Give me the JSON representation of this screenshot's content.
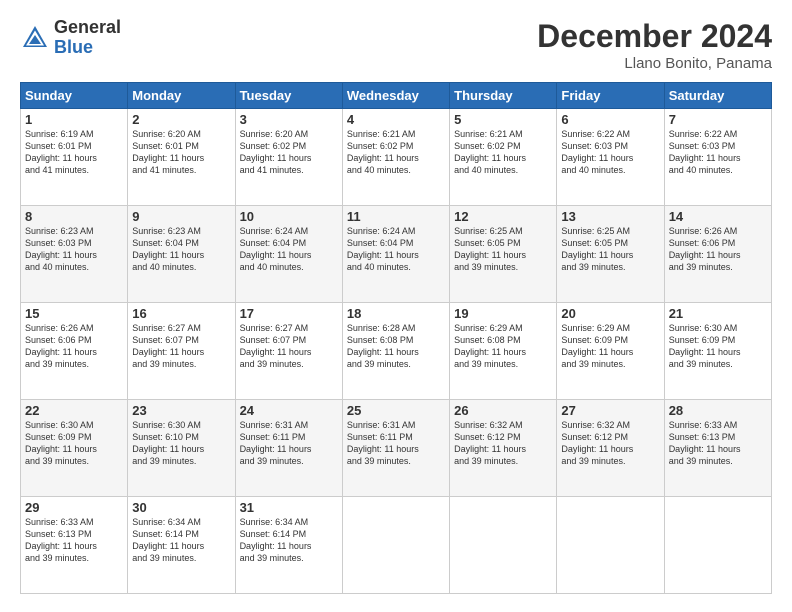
{
  "header": {
    "logo_general": "General",
    "logo_blue": "Blue",
    "title": "December 2024",
    "subtitle": "Llano Bonito, Panama"
  },
  "calendar": {
    "days_of_week": [
      "Sunday",
      "Monday",
      "Tuesday",
      "Wednesday",
      "Thursday",
      "Friday",
      "Saturday"
    ],
    "weeks": [
      [
        {
          "day": "1",
          "info": "Sunrise: 6:19 AM\nSunset: 6:01 PM\nDaylight: 11 hours\nand 41 minutes."
        },
        {
          "day": "2",
          "info": "Sunrise: 6:20 AM\nSunset: 6:01 PM\nDaylight: 11 hours\nand 41 minutes."
        },
        {
          "day": "3",
          "info": "Sunrise: 6:20 AM\nSunset: 6:02 PM\nDaylight: 11 hours\nand 41 minutes."
        },
        {
          "day": "4",
          "info": "Sunrise: 6:21 AM\nSunset: 6:02 PM\nDaylight: 11 hours\nand 40 minutes."
        },
        {
          "day": "5",
          "info": "Sunrise: 6:21 AM\nSunset: 6:02 PM\nDaylight: 11 hours\nand 40 minutes."
        },
        {
          "day": "6",
          "info": "Sunrise: 6:22 AM\nSunset: 6:03 PM\nDaylight: 11 hours\nand 40 minutes."
        },
        {
          "day": "7",
          "info": "Sunrise: 6:22 AM\nSunset: 6:03 PM\nDaylight: 11 hours\nand 40 minutes."
        }
      ],
      [
        {
          "day": "8",
          "info": "Sunrise: 6:23 AM\nSunset: 6:03 PM\nDaylight: 11 hours\nand 40 minutes."
        },
        {
          "day": "9",
          "info": "Sunrise: 6:23 AM\nSunset: 6:04 PM\nDaylight: 11 hours\nand 40 minutes."
        },
        {
          "day": "10",
          "info": "Sunrise: 6:24 AM\nSunset: 6:04 PM\nDaylight: 11 hours\nand 40 minutes."
        },
        {
          "day": "11",
          "info": "Sunrise: 6:24 AM\nSunset: 6:04 PM\nDaylight: 11 hours\nand 40 minutes."
        },
        {
          "day": "12",
          "info": "Sunrise: 6:25 AM\nSunset: 6:05 PM\nDaylight: 11 hours\nand 39 minutes."
        },
        {
          "day": "13",
          "info": "Sunrise: 6:25 AM\nSunset: 6:05 PM\nDaylight: 11 hours\nand 39 minutes."
        },
        {
          "day": "14",
          "info": "Sunrise: 6:26 AM\nSunset: 6:06 PM\nDaylight: 11 hours\nand 39 minutes."
        }
      ],
      [
        {
          "day": "15",
          "info": "Sunrise: 6:26 AM\nSunset: 6:06 PM\nDaylight: 11 hours\nand 39 minutes."
        },
        {
          "day": "16",
          "info": "Sunrise: 6:27 AM\nSunset: 6:07 PM\nDaylight: 11 hours\nand 39 minutes."
        },
        {
          "day": "17",
          "info": "Sunrise: 6:27 AM\nSunset: 6:07 PM\nDaylight: 11 hours\nand 39 minutes."
        },
        {
          "day": "18",
          "info": "Sunrise: 6:28 AM\nSunset: 6:08 PM\nDaylight: 11 hours\nand 39 minutes."
        },
        {
          "day": "19",
          "info": "Sunrise: 6:29 AM\nSunset: 6:08 PM\nDaylight: 11 hours\nand 39 minutes."
        },
        {
          "day": "20",
          "info": "Sunrise: 6:29 AM\nSunset: 6:09 PM\nDaylight: 11 hours\nand 39 minutes."
        },
        {
          "day": "21",
          "info": "Sunrise: 6:30 AM\nSunset: 6:09 PM\nDaylight: 11 hours\nand 39 minutes."
        }
      ],
      [
        {
          "day": "22",
          "info": "Sunrise: 6:30 AM\nSunset: 6:09 PM\nDaylight: 11 hours\nand 39 minutes."
        },
        {
          "day": "23",
          "info": "Sunrise: 6:30 AM\nSunset: 6:10 PM\nDaylight: 11 hours\nand 39 minutes."
        },
        {
          "day": "24",
          "info": "Sunrise: 6:31 AM\nSunset: 6:11 PM\nDaylight: 11 hours\nand 39 minutes."
        },
        {
          "day": "25",
          "info": "Sunrise: 6:31 AM\nSunset: 6:11 PM\nDaylight: 11 hours\nand 39 minutes."
        },
        {
          "day": "26",
          "info": "Sunrise: 6:32 AM\nSunset: 6:12 PM\nDaylight: 11 hours\nand 39 minutes."
        },
        {
          "day": "27",
          "info": "Sunrise: 6:32 AM\nSunset: 6:12 PM\nDaylight: 11 hours\nand 39 minutes."
        },
        {
          "day": "28",
          "info": "Sunrise: 6:33 AM\nSunset: 6:13 PM\nDaylight: 11 hours\nand 39 minutes."
        }
      ],
      [
        {
          "day": "29",
          "info": "Sunrise: 6:33 AM\nSunset: 6:13 PM\nDaylight: 11 hours\nand 39 minutes."
        },
        {
          "day": "30",
          "info": "Sunrise: 6:34 AM\nSunset: 6:14 PM\nDaylight: 11 hours\nand 39 minutes."
        },
        {
          "day": "31",
          "info": "Sunrise: 6:34 AM\nSunset: 6:14 PM\nDaylight: 11 hours\nand 39 minutes."
        },
        {
          "day": "",
          "info": ""
        },
        {
          "day": "",
          "info": ""
        },
        {
          "day": "",
          "info": ""
        },
        {
          "day": "",
          "info": ""
        }
      ]
    ]
  }
}
